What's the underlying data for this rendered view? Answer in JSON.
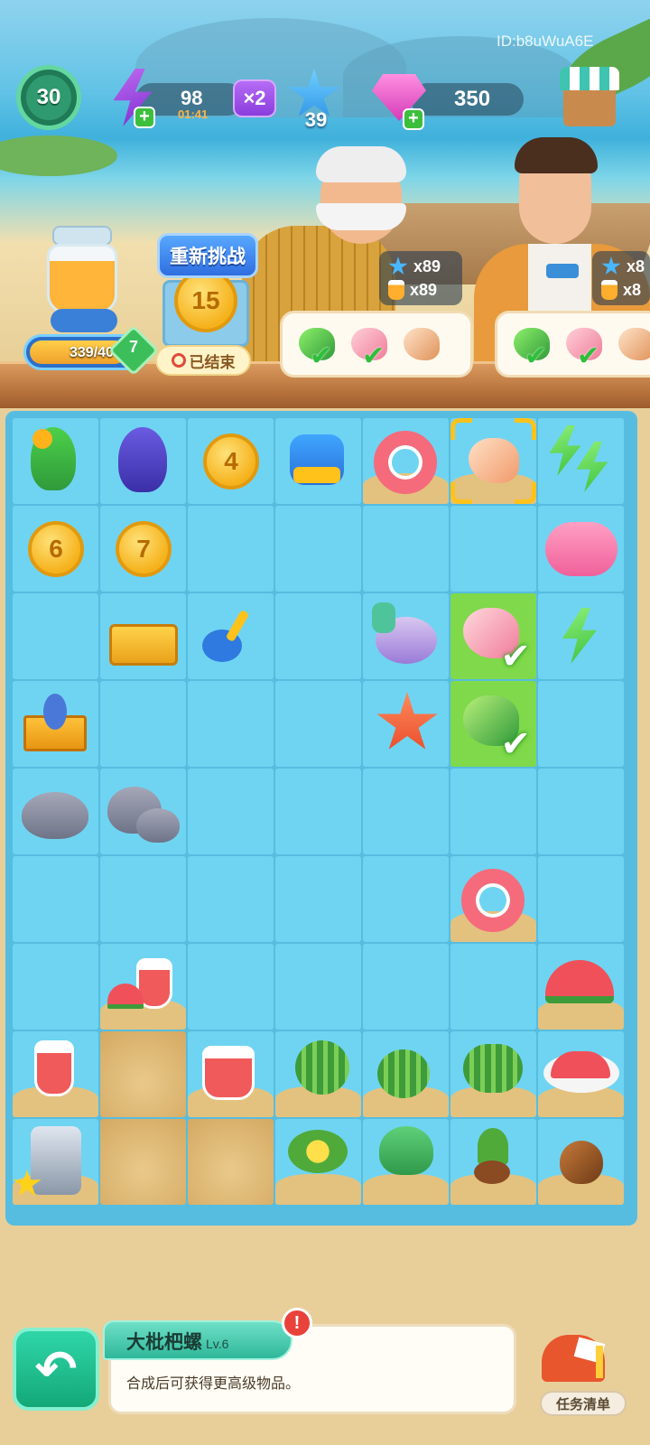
{
  "hud": {
    "player_id": "ID:b8uWuA6E",
    "level": "30",
    "energy": "98",
    "energy_timer": "01:41",
    "multiplier": "×2",
    "stars": "39",
    "gems": "350",
    "icons": {
      "energy": "purple-bolt-icon",
      "star": "blue-star-icon",
      "gem": "pink-gem-icon",
      "shop": "shop-stall-icon"
    }
  },
  "progress": {
    "xp_text": "339/400",
    "xp_fraction": 0.8475,
    "xp_level": "7"
  },
  "event": {
    "rechallenge_label": "重新挑战",
    "coin_value": "15",
    "ended_label": "已结束"
  },
  "orders": [
    {
      "stars": "x89",
      "jars": "x89",
      "items": [
        "green-conch",
        "pink-conch",
        "spiral-shell"
      ],
      "checked": [
        true,
        true,
        false
      ]
    },
    {
      "stars": "x8",
      "jars": "x8",
      "items": [
        "green-conch",
        "pink-conch",
        "spiral-shell"
      ],
      "checked": [
        true,
        true,
        false
      ]
    }
  ],
  "board": {
    "rows": [
      [
        "parrot",
        "blue-bird",
        "coin:4",
        "watering-can",
        "swim-ring",
        "conch-selected",
        "green-bolts"
      ],
      [
        "coin:6",
        "coin:7",
        "",
        "",
        "",
        "",
        "flamingo-float"
      ],
      [
        "",
        "beach-basket",
        "shovel",
        "",
        "coral",
        "pink-conch-done",
        "green-bolt"
      ],
      [
        "surf-basket",
        "",
        "",
        "",
        "starfish",
        "green-conch-done",
        ""
      ],
      [
        "rock",
        "rocks",
        "",
        "",
        "",
        "",
        ""
      ],
      [
        "",
        "",
        "",
        "",
        "",
        "swim-ring",
        ""
      ],
      [
        "",
        "melon-drink",
        "",
        "",
        "",
        "",
        "melon-slices"
      ],
      [
        "juice-glass",
        "sand",
        "juice-pitcher",
        "watermelon",
        "watermelon-small",
        "watermelon-plant",
        "melon-plate"
      ],
      [
        "juicer",
        "sand",
        "sand",
        "flower-plant",
        "leaf-plant",
        "sprout",
        "seed"
      ]
    ],
    "coin_labels": {
      "c1": "4",
      "c2": "6",
      "c3": "7"
    }
  },
  "info": {
    "item_name": "大枇杷螺",
    "item_level": "Lv.6",
    "description": "合成后可获得更高级物品。",
    "alert": "!"
  },
  "task_list_label": "任务清单"
}
